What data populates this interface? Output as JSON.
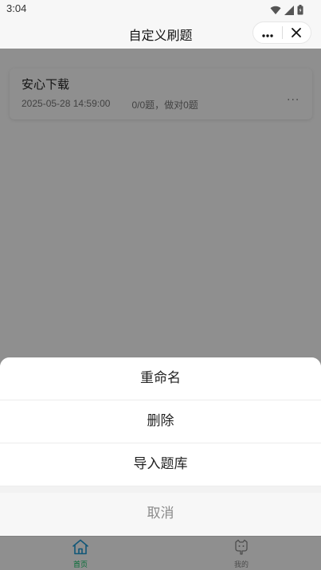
{
  "status_bar": {
    "time": "3:04",
    "icons": [
      "wifi-icon",
      "signal-icon",
      "battery-icon"
    ]
  },
  "header": {
    "title": "自定义刷题",
    "capsule": {
      "more_icon": "more-dots-icon",
      "close_icon": "close-icon"
    }
  },
  "main": {
    "items": [
      {
        "title": "安心下载",
        "date": "2025-05-28 14:59:00",
        "progress": "0/0题，做对0题",
        "more": "···"
      }
    ]
  },
  "action_sheet": {
    "items": [
      {
        "label": "重命名"
      },
      {
        "label": "删除"
      },
      {
        "label": "导入题库"
      }
    ],
    "cancel_label": "取消"
  },
  "tab_bar": {
    "tabs": [
      {
        "label": "首页",
        "icon": "home-icon",
        "active": true
      },
      {
        "label": "我的",
        "icon": "profile-icon",
        "active": false
      }
    ],
    "colors": {
      "active": "#07c160",
      "inactive": "#888888"
    }
  }
}
